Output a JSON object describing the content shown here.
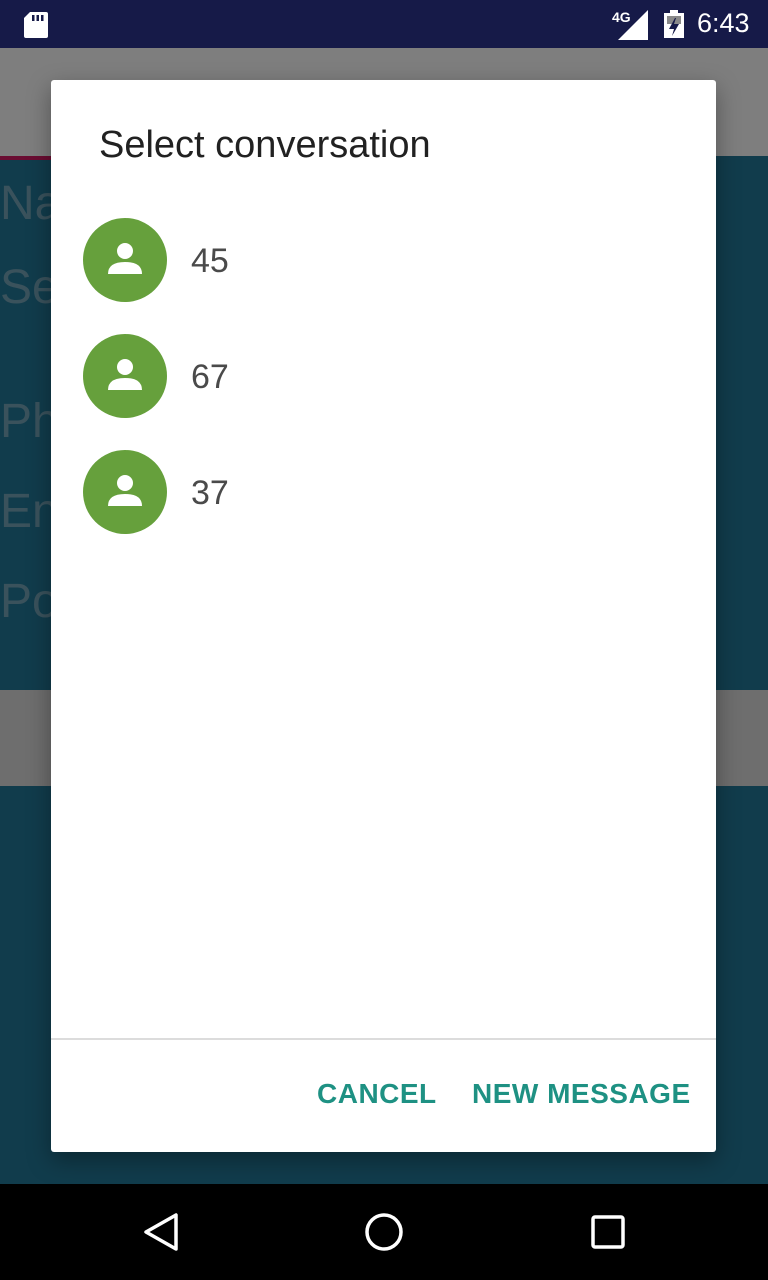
{
  "status_bar": {
    "network_label": "4G",
    "time": "6:43",
    "icons": [
      "sd-card-icon",
      "signal-icon",
      "battery-icon"
    ]
  },
  "background_app": {
    "labels": [
      "Na",
      "Se",
      "Ph",
      "En",
      "Po"
    ]
  },
  "dialog": {
    "title": "Select conversation",
    "conversations": [
      {
        "name": "45",
        "icon": "person-icon"
      },
      {
        "name": "67",
        "icon": "person-icon"
      },
      {
        "name": "37",
        "icon": "person-icon"
      }
    ],
    "buttons": {
      "cancel": "CANCEL",
      "new_message": "NEW MESSAGE"
    }
  },
  "nav_bar": {
    "icons": [
      "back-icon",
      "home-icon",
      "recents-icon"
    ]
  },
  "colors": {
    "status_bar": "#161a48",
    "avatar": "#66a03c",
    "accent_text": "#1e9183"
  }
}
